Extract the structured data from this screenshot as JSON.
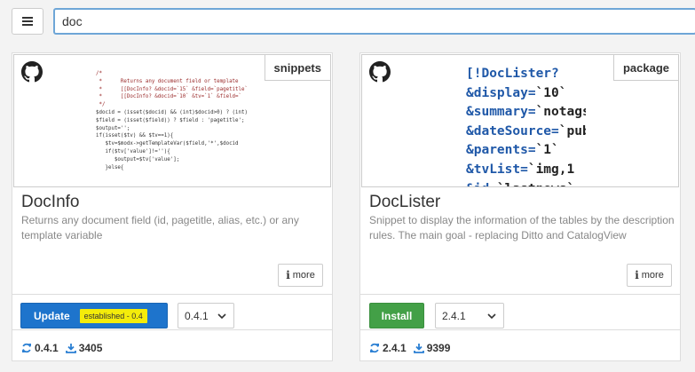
{
  "search": {
    "value": "doc"
  },
  "cards": [
    {
      "title": "DocInfo",
      "tag": "snippets",
      "description": "Returns any document field (id, pagetitle, alias, etc.) or any template variable",
      "more_label": "more",
      "action_label": "Update",
      "badge": "established - 0.4",
      "version_selected": "0.4.1",
      "stat_version": "0.4.1",
      "stat_downloads": "3405",
      "code_lines": [
        "/*",
        " *      Returns any document field or template",
        " *      [[DocInfo? &docid=`15` &field=`pagetitle`",
        " *      [[DocInfo? &docid=`10` &tv=`1` &field=`",
        " */",
        "$docid = (isset($docid) && (int)$docid>0) ? (int)",
        "$field = (isset($field)) ? $field : 'pagetitle';",
        "$output='';",
        "if(isset($tv) && $tv==1){",
        "   $tv=$modx->getTemplateVar($field,'*',$docid",
        "   if($tv['value']!=''){",
        "      $output=$tv['value'];",
        "   }else{"
      ]
    },
    {
      "title": "DocLister",
      "tag": "package",
      "description": "Snippet to display the information of the tables by the description rules. The main goal - replacing Ditto and CatalogView",
      "more_label": "more",
      "action_label": "Install",
      "version_selected": "2.4.1",
      "stat_version": "2.4.1",
      "stat_downloads": "9399",
      "code_lines": [
        {
          "k": "[!DocLister?",
          "v": ""
        },
        {
          "k": "&display=",
          "v": "`10`"
        },
        {
          "k": "&summary=",
          "v": "`notags`"
        },
        {
          "k": "&dateSource=",
          "v": "`pub`"
        },
        {
          "k": "&parents=",
          "v": "`1`"
        },
        {
          "k": "&tvList=",
          "v": "`img,1"
        },
        {
          "k": "&id=",
          "v": "`lastnews`"
        }
      ]
    }
  ]
}
